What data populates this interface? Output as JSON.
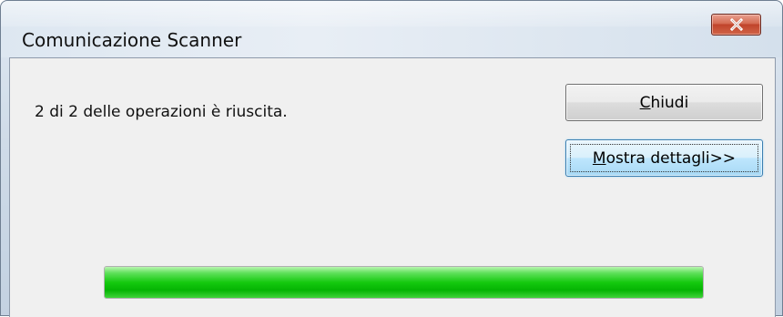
{
  "window": {
    "title": "Comunicazione Scanner",
    "close_icon": "close-icon"
  },
  "dialog": {
    "message": "2 di 2 delle operazioni è riuscita.",
    "buttons": {
      "close": {
        "mnemonic": "C",
        "rest": "hiudi"
      },
      "details": {
        "mnemonic": "M",
        "rest": "ostra dettagli>>"
      }
    },
    "progress": {
      "fraction": 1.0,
      "color": "#15c90f"
    }
  },
  "colors": {
    "close_button": "#c0442b",
    "focus_button": "#3c7fb1"
  }
}
